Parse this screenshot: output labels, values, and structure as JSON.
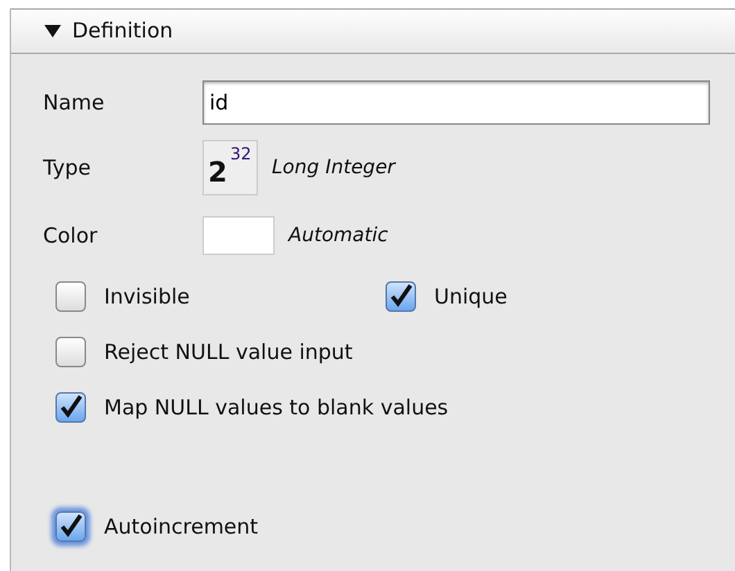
{
  "section": {
    "title": "Definition",
    "expanded": true
  },
  "fields": {
    "name": {
      "label": "Name",
      "value": "id"
    },
    "type": {
      "label": "Type",
      "base": "2",
      "exponent": "32",
      "value": "Long Integer"
    },
    "color": {
      "label": "Color",
      "value": "Automatic"
    }
  },
  "checkbox_rows": [
    [
      {
        "label": "Invisible",
        "checked": false
      },
      {
        "label": "Unique",
        "checked": true
      }
    ],
    [
      {
        "label": "Reject NULL value input",
        "checked": false
      }
    ],
    [
      {
        "label": "Map NULL values to blank values",
        "checked": true
      }
    ]
  ],
  "autoincrement": {
    "label": "Autoincrement",
    "checked": true,
    "focused": true
  }
}
